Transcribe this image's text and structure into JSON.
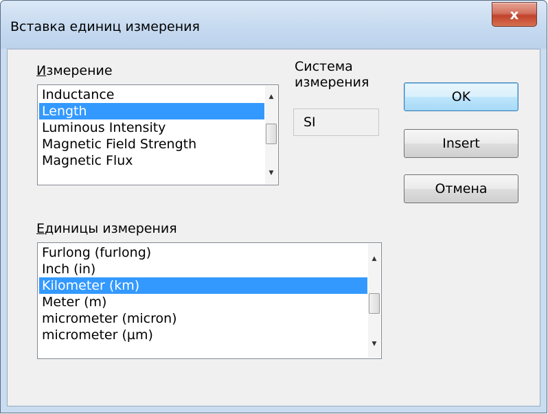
{
  "window": {
    "title": "Вставка единиц измерения",
    "close_glyph": "x"
  },
  "dimension": {
    "label_accel": "И",
    "label_rest": "змерение",
    "items": [
      "Inductance",
      "Length",
      "Luminous Intensity",
      "Magnetic Field Strength",
      "Magnetic Flux"
    ],
    "selected": "Length"
  },
  "system": {
    "label": "Система\nизмерения",
    "value": "SI"
  },
  "units": {
    "label_accel": "Е",
    "label_rest": "диницы измерения",
    "items": [
      "Furlong (furlong)",
      "Inch (in)",
      "Kilometer (km)",
      "Meter (m)",
      "micrometer (micron)",
      "micrometer (µm)"
    ],
    "selected": "Kilometer (km)"
  },
  "buttons": {
    "ok": "OK",
    "insert": "Insert",
    "cancel": "Отмена"
  },
  "icons": {
    "scroll_up": "▲",
    "scroll_down": "▼"
  }
}
